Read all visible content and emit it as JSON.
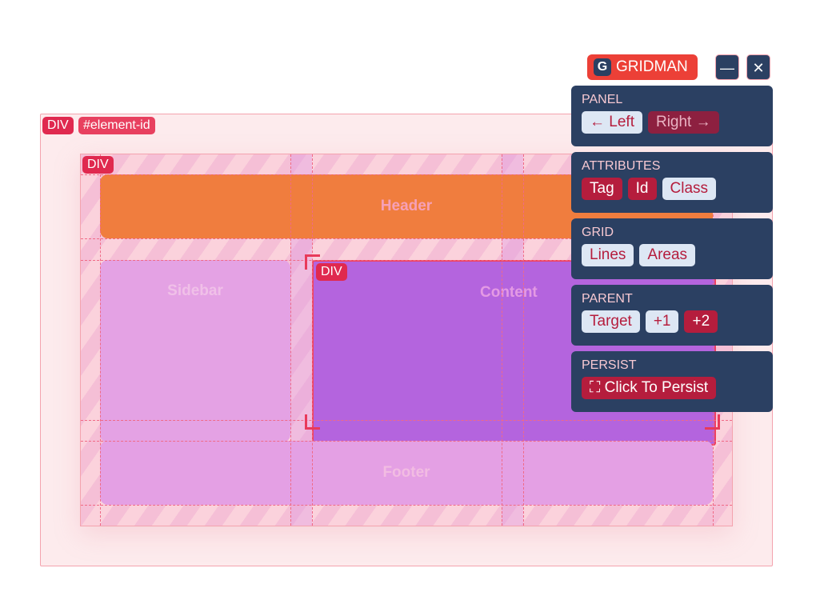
{
  "outer_element": {
    "tag_label": "DIV",
    "id_label": "#element-id"
  },
  "grid_container": {
    "tag_label": "DIV",
    "areas": {
      "header": "Header",
      "sidebar": "Sidebar",
      "content": "Content",
      "footer": "Footer"
    },
    "selected_area_tag": "DIV"
  },
  "gridman": {
    "logo_letter": "G",
    "title": "GRIDMAN",
    "minimize_icon": "—",
    "close_icon": "✕",
    "sections": {
      "panel": {
        "title": "PANEL",
        "left": "← Left",
        "right": "Right →"
      },
      "attributes": {
        "title": "ATTRIBUTES",
        "tag": "Tag",
        "id": "Id",
        "class": "Class"
      },
      "grid": {
        "title": "GRID",
        "lines": "Lines",
        "areas": "Areas"
      },
      "parent": {
        "title": "PARENT",
        "target": "Target",
        "plus1": "+1",
        "plus2": "+2"
      },
      "persist": {
        "title": "PERSIST",
        "icon": "⛶",
        "label": "Click To Persist"
      }
    }
  },
  "colors": {
    "accent_red": "#b51d3d",
    "panel_navy": "#2b4062",
    "brand_red": "#ec4037",
    "header_area": "#f07d3e",
    "content_area": "#b464de",
    "sidebar_area": "#e4a2e4"
  }
}
